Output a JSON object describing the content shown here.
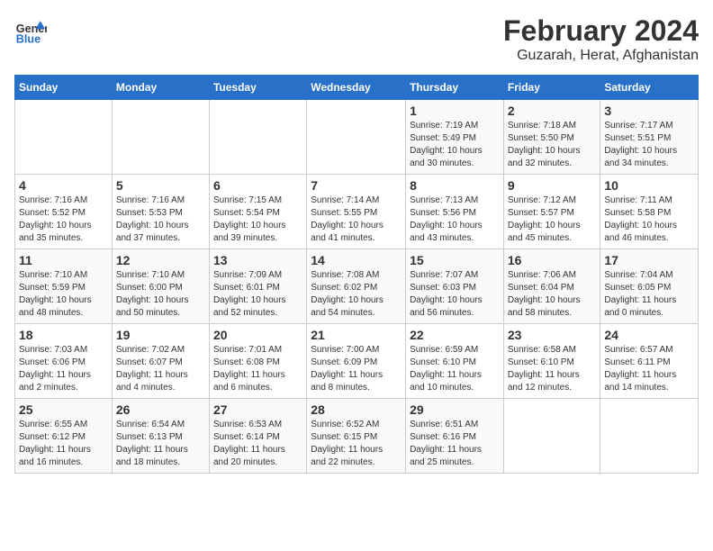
{
  "logo": {
    "general": "General",
    "blue": "Blue"
  },
  "title": "February 2024",
  "subtitle": "Guzarah, Herat, Afghanistan",
  "days_of_week": [
    "Sunday",
    "Monday",
    "Tuesday",
    "Wednesday",
    "Thursday",
    "Friday",
    "Saturday"
  ],
  "weeks": [
    [
      {
        "day": "",
        "info": ""
      },
      {
        "day": "",
        "info": ""
      },
      {
        "day": "",
        "info": ""
      },
      {
        "day": "",
        "info": ""
      },
      {
        "day": "1",
        "info": "Sunrise: 7:19 AM\nSunset: 5:49 PM\nDaylight: 10 hours\nand 30 minutes."
      },
      {
        "day": "2",
        "info": "Sunrise: 7:18 AM\nSunset: 5:50 PM\nDaylight: 10 hours\nand 32 minutes."
      },
      {
        "day": "3",
        "info": "Sunrise: 7:17 AM\nSunset: 5:51 PM\nDaylight: 10 hours\nand 34 minutes."
      }
    ],
    [
      {
        "day": "4",
        "info": "Sunrise: 7:16 AM\nSunset: 5:52 PM\nDaylight: 10 hours\nand 35 minutes."
      },
      {
        "day": "5",
        "info": "Sunrise: 7:16 AM\nSunset: 5:53 PM\nDaylight: 10 hours\nand 37 minutes."
      },
      {
        "day": "6",
        "info": "Sunrise: 7:15 AM\nSunset: 5:54 PM\nDaylight: 10 hours\nand 39 minutes."
      },
      {
        "day": "7",
        "info": "Sunrise: 7:14 AM\nSunset: 5:55 PM\nDaylight: 10 hours\nand 41 minutes."
      },
      {
        "day": "8",
        "info": "Sunrise: 7:13 AM\nSunset: 5:56 PM\nDaylight: 10 hours\nand 43 minutes."
      },
      {
        "day": "9",
        "info": "Sunrise: 7:12 AM\nSunset: 5:57 PM\nDaylight: 10 hours\nand 45 minutes."
      },
      {
        "day": "10",
        "info": "Sunrise: 7:11 AM\nSunset: 5:58 PM\nDaylight: 10 hours\nand 46 minutes."
      }
    ],
    [
      {
        "day": "11",
        "info": "Sunrise: 7:10 AM\nSunset: 5:59 PM\nDaylight: 10 hours\nand 48 minutes."
      },
      {
        "day": "12",
        "info": "Sunrise: 7:10 AM\nSunset: 6:00 PM\nDaylight: 10 hours\nand 50 minutes."
      },
      {
        "day": "13",
        "info": "Sunrise: 7:09 AM\nSunset: 6:01 PM\nDaylight: 10 hours\nand 52 minutes."
      },
      {
        "day": "14",
        "info": "Sunrise: 7:08 AM\nSunset: 6:02 PM\nDaylight: 10 hours\nand 54 minutes."
      },
      {
        "day": "15",
        "info": "Sunrise: 7:07 AM\nSunset: 6:03 PM\nDaylight: 10 hours\nand 56 minutes."
      },
      {
        "day": "16",
        "info": "Sunrise: 7:06 AM\nSunset: 6:04 PM\nDaylight: 10 hours\nand 58 minutes."
      },
      {
        "day": "17",
        "info": "Sunrise: 7:04 AM\nSunset: 6:05 PM\nDaylight: 11 hours\nand 0 minutes."
      }
    ],
    [
      {
        "day": "18",
        "info": "Sunrise: 7:03 AM\nSunset: 6:06 PM\nDaylight: 11 hours\nand 2 minutes."
      },
      {
        "day": "19",
        "info": "Sunrise: 7:02 AM\nSunset: 6:07 PM\nDaylight: 11 hours\nand 4 minutes."
      },
      {
        "day": "20",
        "info": "Sunrise: 7:01 AM\nSunset: 6:08 PM\nDaylight: 11 hours\nand 6 minutes."
      },
      {
        "day": "21",
        "info": "Sunrise: 7:00 AM\nSunset: 6:09 PM\nDaylight: 11 hours\nand 8 minutes."
      },
      {
        "day": "22",
        "info": "Sunrise: 6:59 AM\nSunset: 6:10 PM\nDaylight: 11 hours\nand 10 minutes."
      },
      {
        "day": "23",
        "info": "Sunrise: 6:58 AM\nSunset: 6:10 PM\nDaylight: 11 hours\nand 12 minutes."
      },
      {
        "day": "24",
        "info": "Sunrise: 6:57 AM\nSunset: 6:11 PM\nDaylight: 11 hours\nand 14 minutes."
      }
    ],
    [
      {
        "day": "25",
        "info": "Sunrise: 6:55 AM\nSunset: 6:12 PM\nDaylight: 11 hours\nand 16 minutes."
      },
      {
        "day": "26",
        "info": "Sunrise: 6:54 AM\nSunset: 6:13 PM\nDaylight: 11 hours\nand 18 minutes."
      },
      {
        "day": "27",
        "info": "Sunrise: 6:53 AM\nSunset: 6:14 PM\nDaylight: 11 hours\nand 20 minutes."
      },
      {
        "day": "28",
        "info": "Sunrise: 6:52 AM\nSunset: 6:15 PM\nDaylight: 11 hours\nand 22 minutes."
      },
      {
        "day": "29",
        "info": "Sunrise: 6:51 AM\nSunset: 6:16 PM\nDaylight: 11 hours\nand 25 minutes."
      },
      {
        "day": "",
        "info": ""
      },
      {
        "day": "",
        "info": ""
      }
    ]
  ]
}
